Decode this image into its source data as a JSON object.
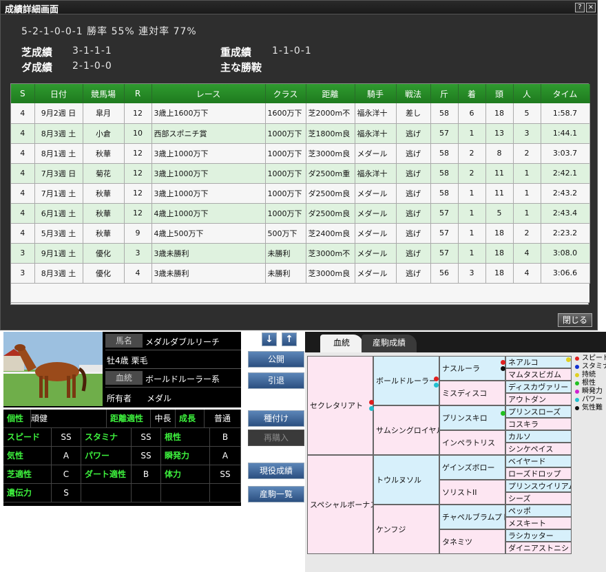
{
  "window": {
    "title": "成績詳細画面",
    "help": "?",
    "close": "×"
  },
  "summary": "5-2-1-0-0-1 勝率 55% 連対率 77%",
  "records": {
    "turf_label": "芝成績",
    "turf_value": "3-1-1-1",
    "dirt_label": "ダ成績",
    "dirt_value": "2-1-0-0",
    "heavy_label": "重成績",
    "heavy_value": "1-1-0-1",
    "training_label": "主な勝鞍"
  },
  "table": {
    "headers": [
      "S",
      "日付",
      "競馬場",
      "R",
      "レース",
      "クラス",
      "距離",
      "騎手",
      "戦法",
      "斤",
      "着",
      "頭",
      "人",
      "タイム"
    ],
    "rows": [
      [
        "4",
        "9月2週 日",
        "皐月",
        "12",
        "3歳上1600万下",
        "1600万下",
        "芝2000m不",
        "福永洋十",
        "差し",
        "58",
        "6",
        "18",
        "5",
        "1:58.7"
      ],
      [
        "4",
        "8月3週 土",
        "小倉",
        "10",
        "西部スポニチ賞",
        "1000万下",
        "芝1800m良",
        "福永洋十",
        "逃げ",
        "57",
        "1",
        "13",
        "3",
        "1:44.1"
      ],
      [
        "4",
        "8月1週 土",
        "秋華",
        "12",
        "3歳上1000万下",
        "1000万下",
        "芝3000m良",
        "メダール",
        "逃げ",
        "58",
        "2",
        "8",
        "2",
        "3:03.7"
      ],
      [
        "4",
        "7月3週 日",
        "菊花",
        "12",
        "3歳上1000万下",
        "1000万下",
        "ダ2500m重",
        "福永洋十",
        "逃げ",
        "58",
        "2",
        "11",
        "1",
        "2:42.1"
      ],
      [
        "4",
        "7月1週 土",
        "秋華",
        "12",
        "3歳上1000万下",
        "1000万下",
        "ダ2500m良",
        "メダール",
        "逃げ",
        "58",
        "1",
        "11",
        "1",
        "2:43.2"
      ],
      [
        "4",
        "6月1週 土",
        "秋華",
        "12",
        "4歳上1000万下",
        "1000万下",
        "ダ2500m良",
        "メダール",
        "逃げ",
        "57",
        "1",
        "5",
        "1",
        "2:43.4"
      ],
      [
        "4",
        "5月3週 土",
        "秋華",
        "9",
        "4歳上500万下",
        "500万下",
        "芝2400m良",
        "メダール",
        "逃げ",
        "57",
        "1",
        "18",
        "2",
        "2:23.2"
      ],
      [
        "3",
        "9月1週 土",
        "優化",
        "3",
        "3歳未勝利",
        "未勝利",
        "芝3000m不",
        "メダール",
        "逃げ",
        "57",
        "1",
        "18",
        "4",
        "3:08.0"
      ],
      [
        "3",
        "8月3週 土",
        "優化",
        "4",
        "3歳未勝利",
        "未勝利",
        "芝3000m良",
        "メダール",
        "逃げ",
        "56",
        "3",
        "18",
        "4",
        "3:06.6"
      ]
    ]
  },
  "close_button": "閉じる",
  "horse": {
    "name_label": "馬名",
    "name": "メダルダブルリーチ",
    "sex_age_color": "牡4歳 栗毛",
    "line_label": "血統",
    "line": "ボールドルーラー系",
    "owner_label": "所有者",
    "owner": "メダル"
  },
  "abilities": {
    "personality_label": "個性",
    "personality": "頑健",
    "distance_label": "距離適性",
    "distance": "中長",
    "growth_label": "成長",
    "growth": "普通",
    "speed_label": "スピード",
    "speed": "SS",
    "stamina_label": "スタミナ",
    "stamina": "SS",
    "guts_label": "根性",
    "guts": "B",
    "temper_label": "気性",
    "temper": "A",
    "power_label": "パワー",
    "power": "SS",
    "burst_label": "瞬発力",
    "burst": "A",
    "turf_label": "芝適性",
    "turf": "C",
    "dirt_label": "ダート適性",
    "dirt": "B",
    "health_label": "体力",
    "health": "SS",
    "heredity_label": "遺伝力",
    "heredity": "S"
  },
  "buttons": {
    "down": "↓",
    "up": "↑",
    "public": "公開",
    "retire": "引退",
    "stud": "種付け",
    "repurchase": "再購入",
    "active_record": "現役成績",
    "offspring_list": "産駒一覧"
  },
  "pedigree": {
    "tab_pedigree": "血統",
    "tab_offspring": "産駒成績",
    "sire": "セクレタリアト",
    "dam": "スペシャルボーナス",
    "g2": [
      "ボールドルーラー",
      "サムシングロイヤル",
      "トウルヌソル",
      "ケンフジ"
    ],
    "g3": [
      "ナスルーラ",
      "ミスディスコ",
      "プリンスキロ",
      "インペラトリス",
      "ゲインズボロー",
      "ソリストII",
      "チャペルブラムプト",
      "タネミツ"
    ],
    "g4": [
      "ネアルコ",
      "マムタスビガム",
      "ディスカヴァリー",
      "アウトダン",
      "プリンスローズ",
      "コスキラ",
      "カルソ",
      "シンケペイス",
      "ベイヤード",
      "ローズドロップ",
      "プリンスウイリアム",
      "シーズ",
      "ペッポ",
      "メスキート",
      "ラシカッター",
      "ダイニアストニシ"
    ]
  },
  "legend": [
    {
      "label": "スピード",
      "color": "#e02020"
    },
    {
      "label": "スタミナ",
      "color": "#1030d0"
    },
    {
      "label": "持続",
      "color": "#e0d020"
    },
    {
      "label": "根性",
      "color": "#20c020"
    },
    {
      "label": "瞬発力",
      "color": "#d020d0"
    },
    {
      "label": "パワー",
      "color": "#20c0d0"
    },
    {
      "label": "気性難",
      "color": "#101010"
    }
  ]
}
